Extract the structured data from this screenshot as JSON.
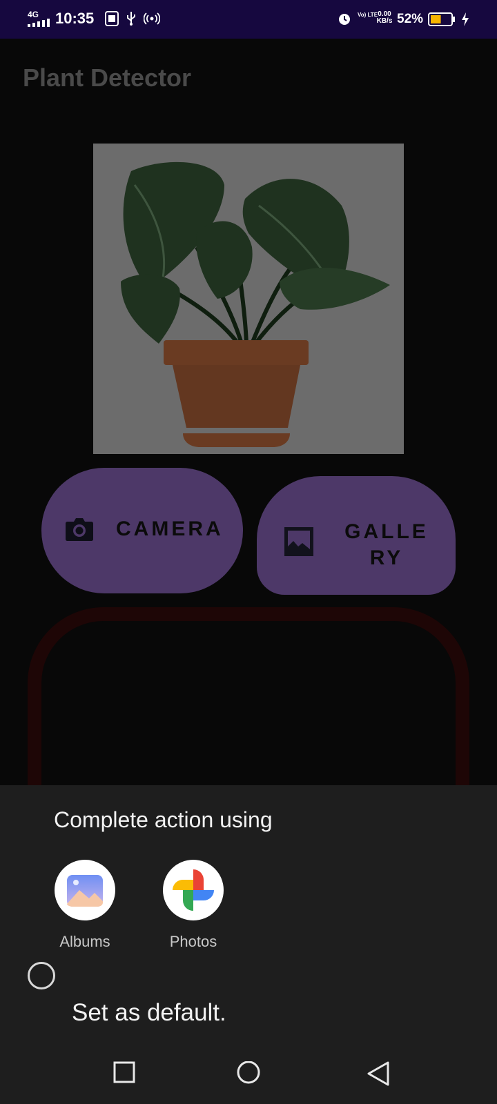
{
  "status_bar": {
    "network": "4G",
    "time": "10:35",
    "lte_label": "Vo) LTE",
    "speed": "0.00 KB/s",
    "battery_percent": "52%",
    "battery_level": 0.52,
    "icons": [
      "signal-icon",
      "sim-icon",
      "usb-icon",
      "hotspot-icon",
      "alarm-icon",
      "battery-icon",
      "charging-icon"
    ]
  },
  "app": {
    "title": "Plant Detector",
    "camera_button_label": "CAMERA",
    "gallery_button_label": "GALLERY",
    "colors": {
      "button": "#4d3868",
      "background": "#080808",
      "image_bg": "#6c6c6c",
      "frame": "#1e0606"
    }
  },
  "chooser": {
    "title": "Complete action using",
    "options": [
      {
        "label": "Albums",
        "icon": "albums-app-icon"
      },
      {
        "label": "Photos",
        "icon": "google-photos-icon"
      }
    ],
    "default_label": "Set as default.",
    "default_checked": false
  },
  "nav_bar": {
    "buttons": [
      "recents-icon",
      "home-icon",
      "back-icon"
    ]
  }
}
